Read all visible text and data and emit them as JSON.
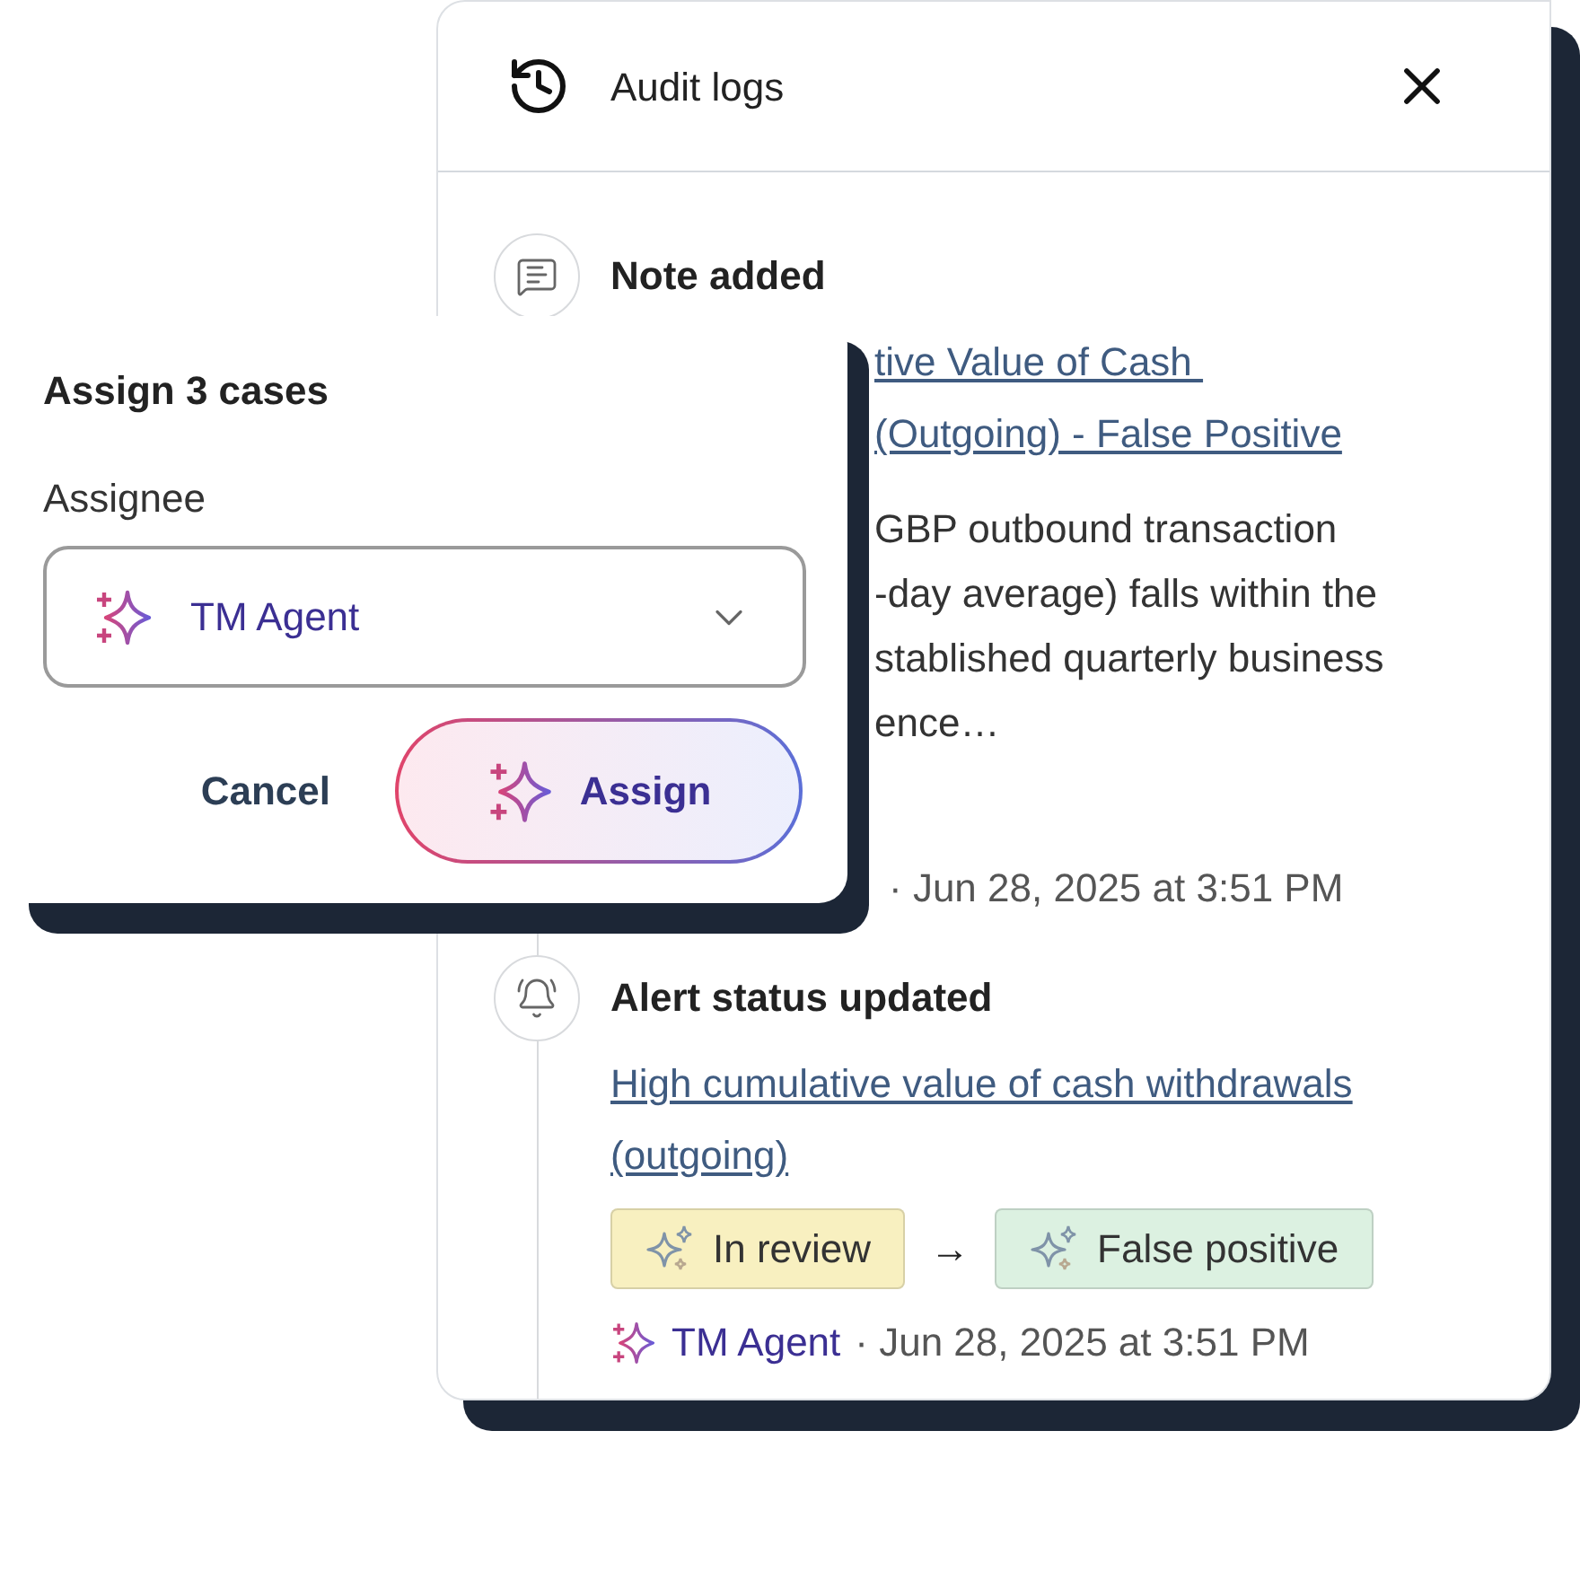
{
  "panel": {
    "title": "Audit logs",
    "entries": [
      {
        "kind": "note",
        "title": "Note added",
        "link_lines": [
          "tive Value of Cash ",
          "(Outgoing) - False Positive"
        ],
        "body_lines": [
          "GBP outbound transaction",
          "-day average) falls within the",
          "stablished quarterly business",
          "ence…"
        ],
        "date": "· Jun 28, 2025 at 3:51 PM"
      },
      {
        "kind": "status",
        "title": "Alert status updated",
        "link_lines": [
          "High cumulative value of cash withdrawals",
          "(outgoing)"
        ],
        "statuses": [
          {
            "label": "In review",
            "color": "#f8f0c0"
          },
          {
            "label": "False positive",
            "color": "#dcf1e1"
          }
        ],
        "arrow": "→",
        "agent": "TM Agent",
        "date": "· Jun 28, 2025 at 3:51 PM"
      }
    ]
  },
  "dialog": {
    "title": "Assign 3 cases",
    "field_label": "Assignee",
    "value": "TM Agent",
    "buttons": [
      "Cancel",
      "Assign"
    ]
  }
}
